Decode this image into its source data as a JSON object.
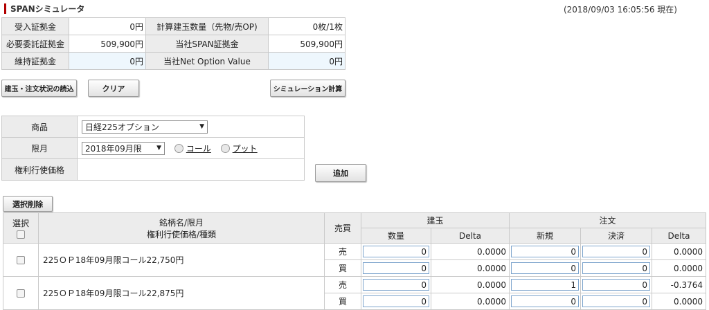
{
  "header": {
    "title": "SPANシミュレータ",
    "timestamp": "(2018/09/03 16:05:56 現在)"
  },
  "summary": {
    "rows": [
      {
        "l1": "受入証拠金",
        "v1": "0円",
        "l2": "計算建玉数量（先物/売OP)",
        "v2": "0枚/1枚"
      },
      {
        "l1": "必要委託証拠金",
        "v1": "509,900円",
        "l2": "当社SPAN証拠金",
        "v2": "509,900円"
      },
      {
        "l1": "維持証拠金",
        "v1": "0円",
        "l2": "当社Net Option Value",
        "v2": "0円"
      }
    ]
  },
  "buttons": {
    "load": "建玉・注文状況の読込",
    "clear": "クリア",
    "calc": "シミュレーション計算",
    "add": "追加",
    "delete_selected": "選択削除"
  },
  "form": {
    "product_label": "商品",
    "product_value": "日経225オプション",
    "month_label": "限月",
    "month_value": "2018年09月限",
    "call_label": "コール",
    "put_label": "プット",
    "strike_label": "権利行使価格",
    "strike_value": ""
  },
  "grid": {
    "headers": {
      "select": "選択",
      "name_line1": "銘柄名/限月",
      "name_line2": "権利行使価格/種類",
      "side": "売買",
      "position": "建玉",
      "order": "注文",
      "qty": "数量",
      "delta": "Delta",
      "new": "新規",
      "settle": "決済",
      "order_delta": "Delta"
    },
    "rows": [
      {
        "name": "225ＯＰ18年09月限コール22,750円",
        "sell": {
          "side": "売",
          "qty": "0",
          "delta": "0.0000",
          "new": "0",
          "settle": "0",
          "odelta": "0.0000"
        },
        "buy": {
          "side": "買",
          "qty": "0",
          "delta": "0.0000",
          "new": "0",
          "settle": "0",
          "odelta": "0.0000"
        }
      },
      {
        "name": "225ＯＰ18年09月限コール22,875円",
        "sell": {
          "side": "売",
          "qty": "0",
          "delta": "0.0000",
          "new": "1",
          "settle": "0",
          "odelta": "-0.3764"
        },
        "buy": {
          "side": "買",
          "qty": "0",
          "delta": "0.0000",
          "new": "0",
          "settle": "0",
          "odelta": "0.0000"
        }
      }
    ]
  }
}
